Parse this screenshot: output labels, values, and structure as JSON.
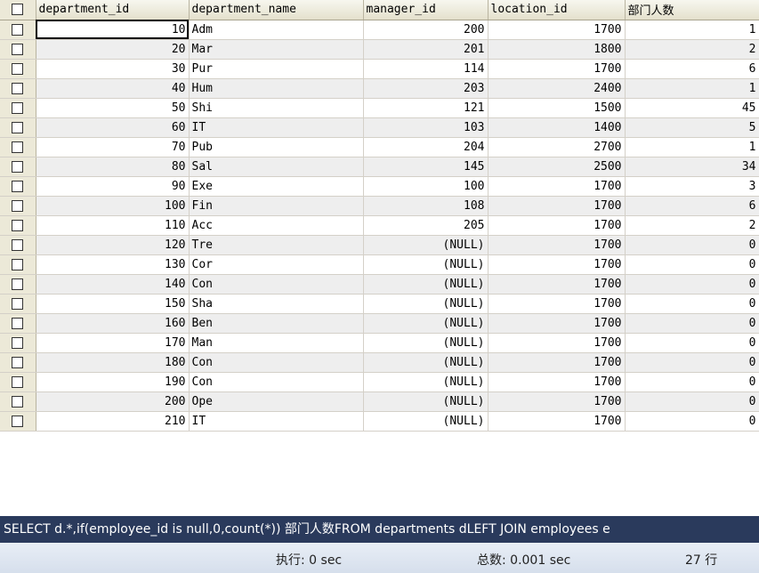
{
  "grid": {
    "columns": [
      "department_id",
      "department_name",
      "manager_id",
      "location_id",
      "部门人数"
    ],
    "rows": [
      [
        "10",
        "Adm",
        "200",
        "1700",
        "1"
      ],
      [
        "20",
        "Mar",
        "201",
        "1800",
        "2"
      ],
      [
        "30",
        "Pur",
        "114",
        "1700",
        "6"
      ],
      [
        "40",
        "Hum",
        "203",
        "2400",
        "1"
      ],
      [
        "50",
        "Shi",
        "121",
        "1500",
        "45"
      ],
      [
        "60",
        "IT",
        "103",
        "1400",
        "5"
      ],
      [
        "70",
        "Pub",
        "204",
        "2700",
        "1"
      ],
      [
        "80",
        "Sal",
        "145",
        "2500",
        "34"
      ],
      [
        "90",
        "Exe",
        "100",
        "1700",
        "3"
      ],
      [
        "100",
        "Fin",
        "108",
        "1700",
        "6"
      ],
      [
        "110",
        "Acc",
        "205",
        "1700",
        "2"
      ],
      [
        "120",
        "Tre",
        "(NULL)",
        "1700",
        "0"
      ],
      [
        "130",
        "Cor",
        "(NULL)",
        "1700",
        "0"
      ],
      [
        "140",
        "Con",
        "(NULL)",
        "1700",
        "0"
      ],
      [
        "150",
        "Sha",
        "(NULL)",
        "1700",
        "0"
      ],
      [
        "160",
        "Ben",
        "(NULL)",
        "1700",
        "0"
      ],
      [
        "170",
        "Man",
        "(NULL)",
        "1700",
        "0"
      ],
      [
        "180",
        "Con",
        "(NULL)",
        "1700",
        "0"
      ],
      [
        "190",
        "Con",
        "(NULL)",
        "1700",
        "0"
      ],
      [
        "200",
        "Ope",
        "(NULL)",
        "1700",
        "0"
      ],
      [
        "210",
        "IT",
        "(NULL)",
        "1700",
        "0"
      ]
    ]
  },
  "sql_text": "SELECT d.*,if(employee_id is null,0,count(*)) 部门人数FROM departments dLEFT JOIN employees e",
  "status": {
    "exec": "执行: 0 sec",
    "total": "总数: 0.001 sec",
    "rows": "27 行"
  }
}
